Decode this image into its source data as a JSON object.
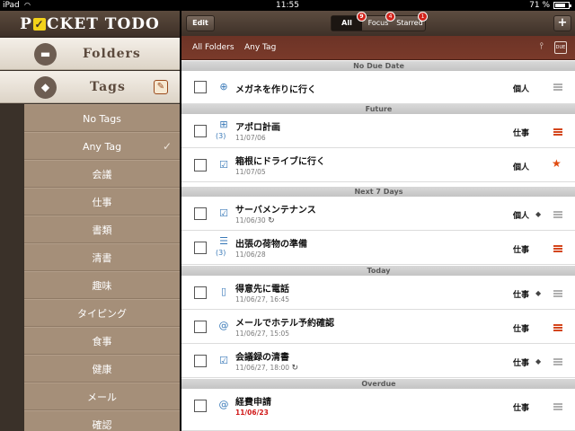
{
  "status": {
    "device": "iPad",
    "time": "11:55",
    "battery": "71 %"
  },
  "sidebar": {
    "logo": {
      "pre": "P",
      "post": "CKET TODO"
    },
    "folders_label": "Folders",
    "tags_label": "Tags",
    "tags": [
      {
        "label": "No Tags"
      },
      {
        "label": "Any Tag",
        "checked": true
      },
      {
        "label": "会議"
      },
      {
        "label": "仕事"
      },
      {
        "label": "書類"
      },
      {
        "label": "清書"
      },
      {
        "label": "趣味"
      },
      {
        "label": "タイピング"
      },
      {
        "label": "食事"
      },
      {
        "label": "健康"
      },
      {
        "label": "メール"
      },
      {
        "label": "確認"
      }
    ]
  },
  "toolbar": {
    "edit_label": "Edit",
    "segments": {
      "all": "All",
      "focus": "Focus",
      "starred": "Starred"
    },
    "badges": {
      "all": "9",
      "focus": "4",
      "starred": "1"
    },
    "add_label": "+"
  },
  "filter": {
    "folder": "All Folders",
    "tag": "Any Tag",
    "due_label": "DUE"
  },
  "sections": {
    "no_due": "No Due Date",
    "future": "Future",
    "next7": "Next 7 Days",
    "today": "Today",
    "overdue": "Overdue"
  },
  "tasks": [
    {
      "title": "メガネを作りに行く",
      "date": "",
      "folder": "個人",
      "count": "",
      "priority": "none"
    },
    {
      "title": "アポロ計画",
      "date": "11/07/06",
      "folder": "仕事",
      "count": "(3)",
      "priority": "high"
    },
    {
      "title": "箱根にドライブに行く",
      "date": "11/07/05",
      "folder": "個人",
      "count": "",
      "priority": "star"
    },
    {
      "title": "サーバメンテナンス",
      "date": "11/06/30",
      "folder": "個人",
      "count": "",
      "priority": "none"
    },
    {
      "title": "出張の荷物の準備",
      "date": "11/06/28",
      "folder": "仕事",
      "count": "(3)",
      "priority": "high"
    },
    {
      "title": "得意先に電話",
      "date": "11/06/27, 16:45",
      "folder": "仕事",
      "count": "",
      "priority": "none"
    },
    {
      "title": "メールでホテル予約確認",
      "date": "11/06/27, 15:05",
      "folder": "仕事",
      "count": "",
      "priority": "high"
    },
    {
      "title": "会議録の清書",
      "date": "11/06/27, 18:00",
      "folder": "仕事",
      "count": "",
      "priority": "none"
    },
    {
      "title": "経費申請",
      "date": "11/06/23",
      "folder": "仕事",
      "count": "",
      "priority": "none"
    }
  ],
  "icons": {
    "task_types": [
      "target-icon",
      "project-icon",
      "checklist-icon",
      "checklist-icon",
      "list-icon",
      "phone-icon",
      "email-icon",
      "checklist-icon",
      "email-icon"
    ]
  },
  "colors": {
    "sidebar_dark": "#3a3129",
    "tag_list": "#a58f79",
    "filter_bar": "#6c3326",
    "overdue": "#d01818",
    "star": "#e04b10"
  }
}
